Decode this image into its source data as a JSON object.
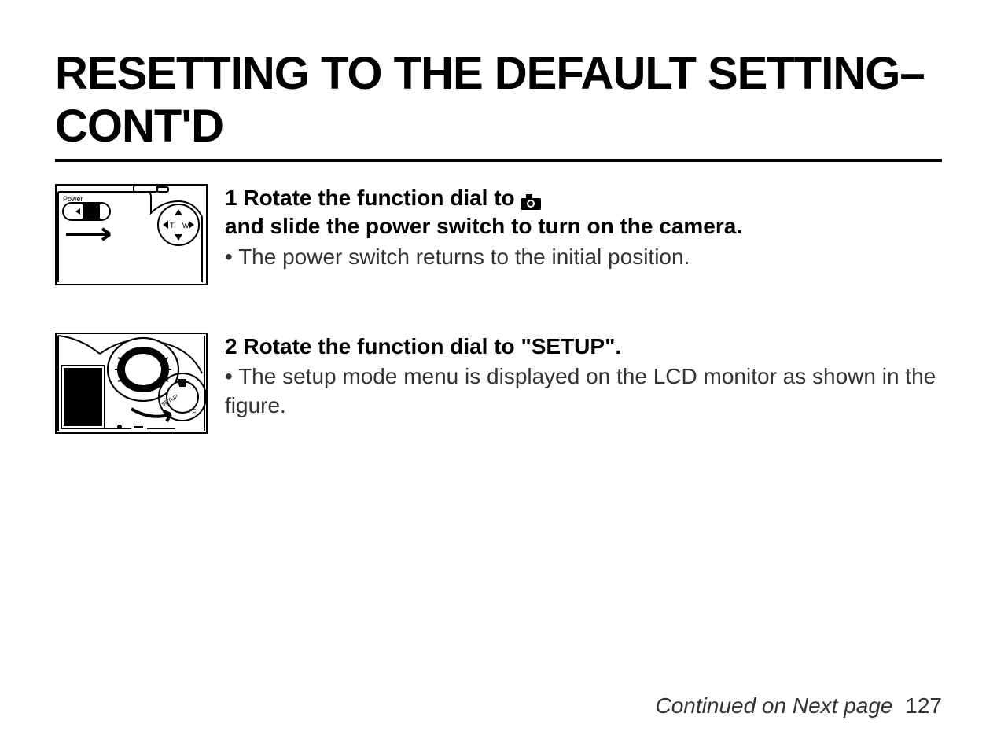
{
  "title": "RESETTING TO THE DEFAULT SETTING– CONT'D",
  "step1": {
    "heading_pre": "1 Rotate the function dial to ",
    "heading_post": " and slide the power switch to turn on the camera.",
    "bullet": "• The power switch returns to the initial position."
  },
  "step2": {
    "heading": "2  Rotate the function dial to \"SETUP\".",
    "bullet": "• The setup mode menu is displayed on the LCD monitor as shown in the figure."
  },
  "footer": {
    "text": "Continued on Next page",
    "page": "127"
  }
}
